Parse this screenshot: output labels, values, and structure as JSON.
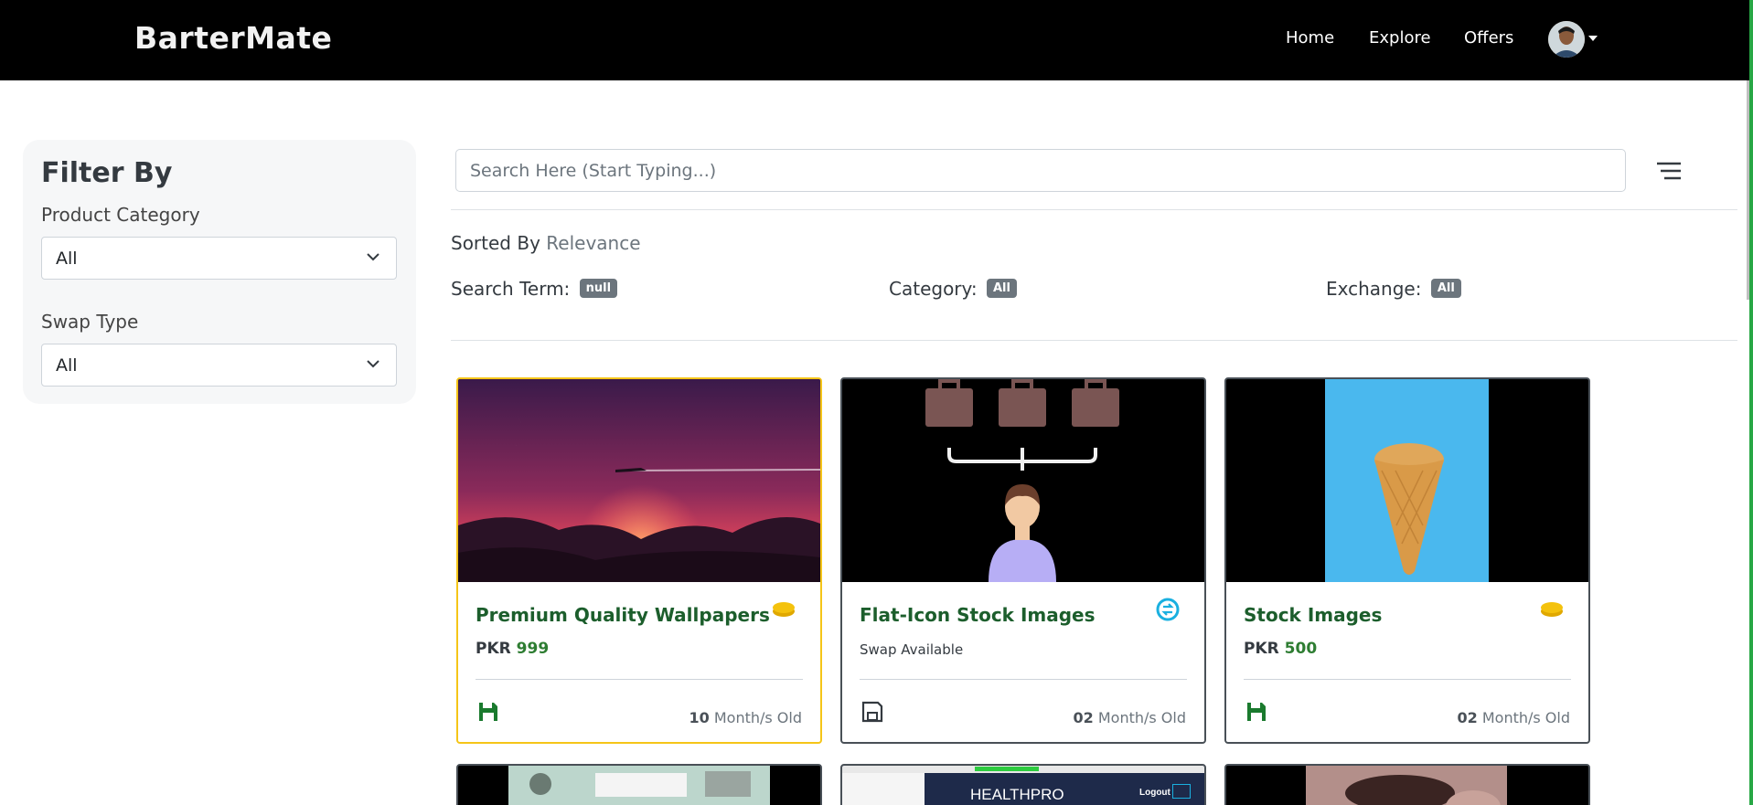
{
  "nav": {
    "brand": "BarterMate",
    "links": [
      "Home",
      "Explore",
      "Offers"
    ]
  },
  "filters": {
    "title": "Filter By",
    "product_category_label": "Product Category",
    "product_category_value": "All",
    "swap_type_label": "Swap Type",
    "swap_type_value": "All"
  },
  "search": {
    "placeholder": "Search Here (Start Typing...)"
  },
  "sort": {
    "prefix": "Sorted By",
    "value": "Relevance"
  },
  "criteria": {
    "search_term_label": "Search Term:",
    "search_term_value": "null",
    "category_label": "Category:",
    "category_value": "All",
    "exchange_label": "Exchange:",
    "exchange_value": "All"
  },
  "cards": [
    {
      "title": "Premium Quality Wallpapers",
      "price_currency": "PKR",
      "price_value": "999",
      "age_number": "10",
      "age_unit": "Month/s Old",
      "type_icon": "coin-icon"
    },
    {
      "title": "Flat-Icon Stock Images",
      "swap_text": "Swap Available",
      "age_number": "02",
      "age_unit": "Month/s Old",
      "type_icon": "swap-icon"
    },
    {
      "title": "Stock Images",
      "price_currency": "PKR",
      "price_value": "500",
      "age_number": "02",
      "age_unit": "Month/s Old",
      "type_icon": "coin-icon"
    }
  ],
  "partial_cards": {
    "healthpro_logo": "HEALTHPRO",
    "healthpro_logout": "Logout"
  },
  "colors": {
    "brand_green": "#1c5e2c",
    "featured_border": "#f5c518",
    "badge": "#6c757d",
    "coin": "#f4c20d",
    "swap": "#1ab0e0"
  }
}
